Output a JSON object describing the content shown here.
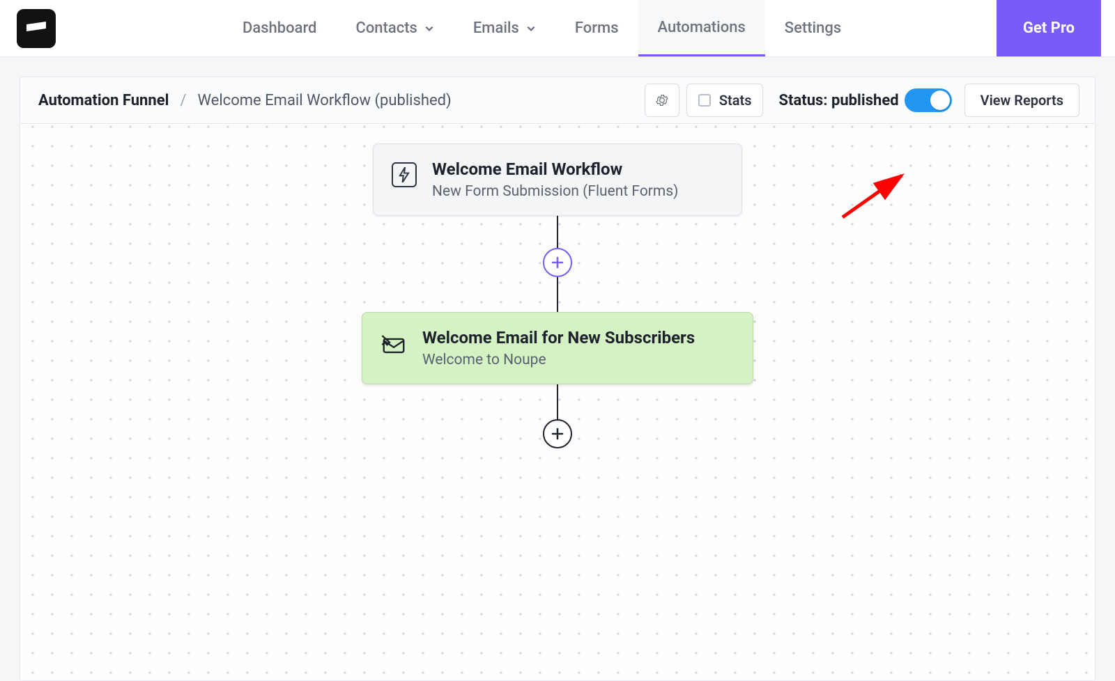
{
  "nav": {
    "dashboard": "Dashboard",
    "contacts": "Contacts",
    "emails": "Emails",
    "forms": "Forms",
    "automations": "Automations",
    "settings": "Settings",
    "get_pro": "Get Pro"
  },
  "breadcrumb": {
    "root": "Automation Funnel",
    "sep": "/",
    "page": "Welcome Email Workflow (published)"
  },
  "toolbar": {
    "stats_label": "Stats",
    "status_label": "Status: published",
    "view_reports": "View Reports"
  },
  "workflow": {
    "trigger": {
      "title": "Welcome Email Workflow",
      "subtitle": "New Form Submission (Fluent Forms)"
    },
    "action": {
      "title": "Welcome Email for New Subscribers",
      "subtitle": "Welcome to Noupe"
    }
  },
  "colors": {
    "accent": "#7a5af8",
    "toggle_on": "#2196f3",
    "action_bg": "#d5f2c4"
  }
}
